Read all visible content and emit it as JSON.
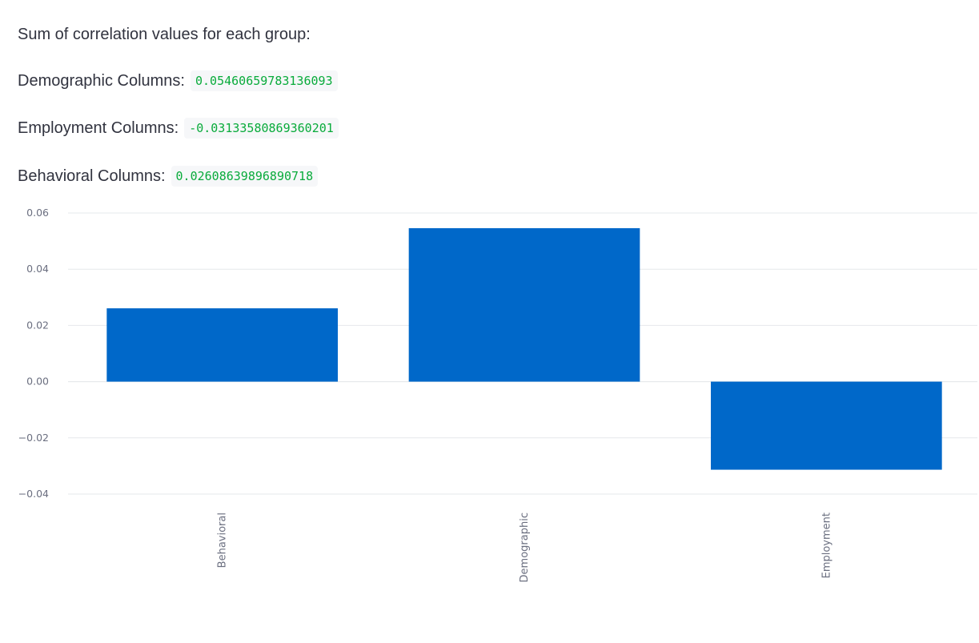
{
  "intro_text": "Sum of correlation values for each group:",
  "metrics": [
    {
      "label": "Demographic Columns:",
      "value": "0.05460659783136093"
    },
    {
      "label": "Employment Columns:",
      "value": "-0.03133580869360201"
    },
    {
      "label": "Behavioral Columns:",
      "value": "0.02608639896890718"
    }
  ],
  "chart_data": {
    "type": "bar",
    "categories": [
      "Behavioral",
      "Demographic",
      "Employment"
    ],
    "values": [
      0.02608639896890718,
      0.05460659783136093,
      -0.03133580869360201
    ],
    "ylim": [
      -0.04,
      0.06
    ],
    "yticks": [
      0.06,
      0.04,
      0.02,
      0.0,
      -0.02,
      -0.04
    ],
    "ytick_labels": [
      "0.06",
      "0.04",
      "0.02",
      "0.00",
      "−0.02",
      "−0.04"
    ],
    "grid": true,
    "bar_color": "#0068c9",
    "grid_color": "#e6e8eb",
    "title": "",
    "xlabel": "",
    "ylabel": ""
  }
}
